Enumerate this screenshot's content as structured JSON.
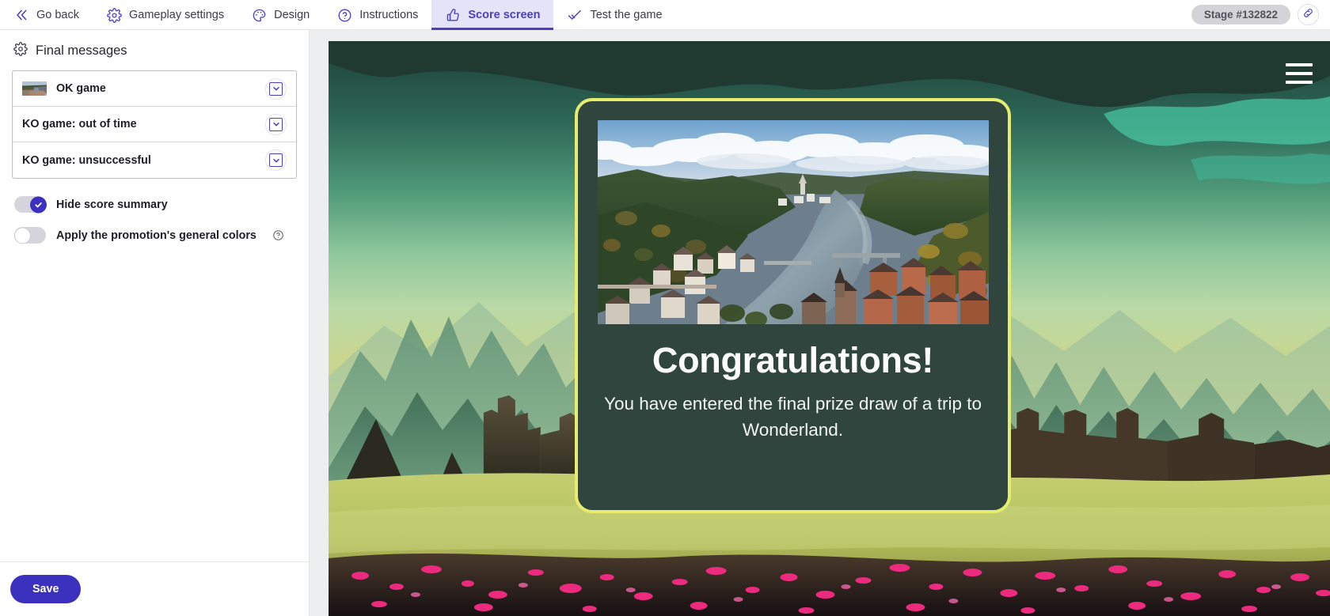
{
  "topnav": {
    "tabs": [
      {
        "label": "Go back",
        "icon": "chevrons-left-icon",
        "active": false
      },
      {
        "label": "Gameplay settings",
        "icon": "gear-icon",
        "active": false
      },
      {
        "label": "Design",
        "icon": "palette-icon",
        "active": false
      },
      {
        "label": "Instructions",
        "icon": "question-circle-icon",
        "active": false
      },
      {
        "label": "Score screen",
        "icon": "thumbs-up-icon",
        "active": true
      },
      {
        "label": "Test the game",
        "icon": "check-icon",
        "active": false
      }
    ],
    "stage_badge": "Stage #132822",
    "link_icon": "link-icon",
    "accent_color": "#4a40c4",
    "active_tab_bg": "#e4e3f8"
  },
  "sidebar": {
    "panel_title": "Final messages",
    "panel_icon": "gear-icon",
    "messages": [
      {
        "label": "OK game",
        "has_thumbnail": true,
        "chevron_icon": "chevron-down-icon"
      },
      {
        "label": "KO game: out of time",
        "has_thumbnail": false,
        "chevron_icon": "chevron-down-icon"
      },
      {
        "label": "KO game: unsuccessful",
        "has_thumbnail": false,
        "chevron_icon": "chevron-down-icon"
      }
    ],
    "toggles": [
      {
        "label": "Hide score summary",
        "state": "on",
        "has_help": false
      },
      {
        "label": "Apply the promotion's general colors",
        "state": "off",
        "has_help": true,
        "help_icon": "question-circle-icon"
      }
    ],
    "save_label": "Save",
    "save_color": "#3c31be"
  },
  "preview": {
    "menu_icon": "hamburger-menu-icon",
    "card": {
      "title": "Congratulations!",
      "body": "You have entered the final prize draw of a trip to Wonderland.",
      "border_color": "#e8ec6e",
      "background_color": "#2f453d",
      "image_alt": "aerial-river-valley-town-photo"
    },
    "background_alt": "fantasy-green-landscape-with-castle"
  }
}
